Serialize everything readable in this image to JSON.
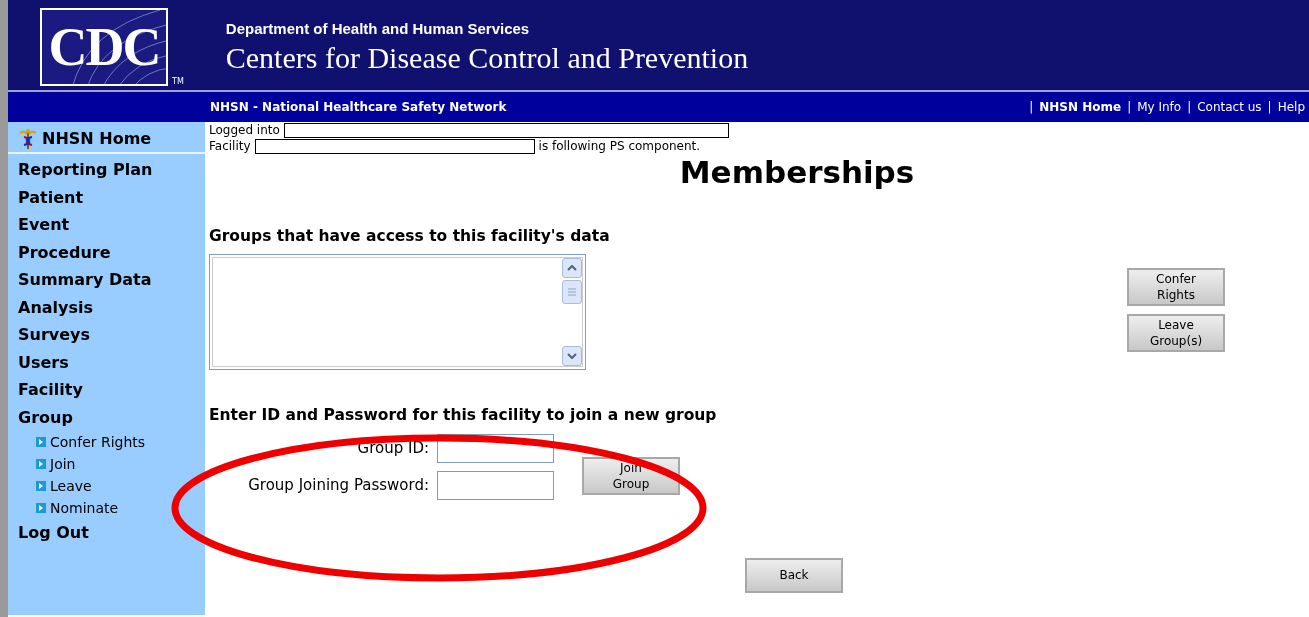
{
  "header": {
    "logo_text": "CDC",
    "logo_mark": "TM",
    "department": "Department of Health and Human Services",
    "agency": "Centers for Disease Control and Prevention"
  },
  "nav_bar": {
    "title": "NHSN - National Healthcare Safety Network",
    "links": [
      {
        "separator": "|",
        "label": "NHSN Home",
        "selected": true
      },
      {
        "separator": "|",
        "label": "My Info",
        "selected": false
      },
      {
        "separator": "|",
        "label": "Contact us",
        "selected": false
      },
      {
        "separator": "|",
        "label": "Help",
        "selected": false
      }
    ]
  },
  "sidebar": {
    "home": "NHSN Home",
    "items": [
      {
        "label": "Reporting Plan"
      },
      {
        "label": "Patient"
      },
      {
        "label": "Event"
      },
      {
        "label": "Procedure"
      },
      {
        "label": "Summary Data"
      },
      {
        "label": "Analysis"
      },
      {
        "label": "Surveys"
      },
      {
        "label": "Users"
      },
      {
        "label": "Facility"
      },
      {
        "label": "Group",
        "children": [
          {
            "label": "Confer Rights"
          },
          {
            "label": "Join"
          },
          {
            "label": "Leave"
          },
          {
            "label": "Nominate"
          }
        ]
      },
      {
        "label": "Log Out"
      }
    ]
  },
  "status": {
    "logged_into_label": "Logged into",
    "facility_label": "Facility",
    "facility_suffix": "is following PS component."
  },
  "title": "Memberships",
  "groups": {
    "heading": "Groups that have access to this facility's data",
    "buttons": [
      "Confer Rights",
      "Leave Group(s)"
    ]
  },
  "join": {
    "heading": "Enter ID and Password for this facility to join a new group",
    "fields": [
      {
        "label": "Group ID:"
      },
      {
        "label": "Group Joining Password:"
      }
    ],
    "button": "Join Group"
  },
  "back_button": "Back",
  "annotation": {
    "kind": "ellipse"
  }
}
